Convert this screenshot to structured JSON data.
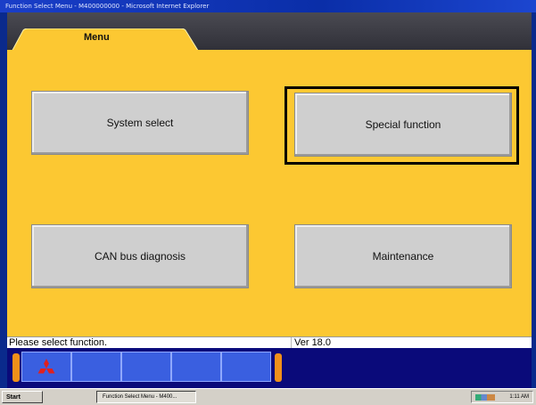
{
  "window": {
    "title": "Function Select Menu - M400000000 - Microsoft Internet Explorer"
  },
  "tabs": [
    {
      "label": "Menu"
    }
  ],
  "functions": {
    "system_select": "System select",
    "special_function": "Special function",
    "can_bus": "CAN bus diagnosis",
    "maintenance": "Maintenance",
    "selected": "special_function"
  },
  "status": {
    "message": "Please select function.",
    "version": "Ver 18.0"
  },
  "toolbar": {
    "logo_icon": "mitsubishi-logo-icon",
    "slot_count": 5
  },
  "taskbar": {
    "start": "Start",
    "task": "Function Select Menu - M400...",
    "clock": "1:11 AM"
  },
  "colors": {
    "background": "#fcc832",
    "button": "#cfcfcf",
    "bottombar": "#0a0a7a",
    "accent": "#f0901a"
  }
}
